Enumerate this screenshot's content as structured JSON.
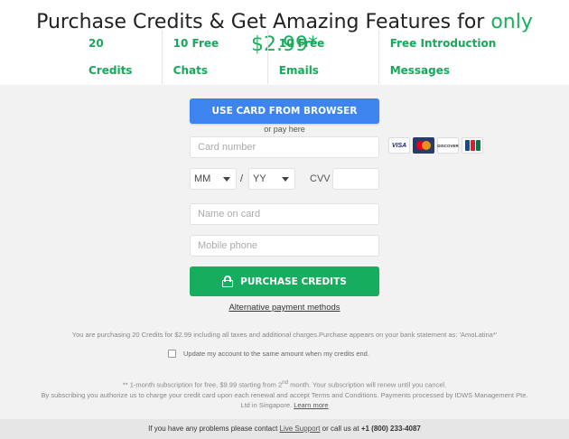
{
  "header": {
    "title_prefix": "Purchase Credits & Get Amazing Features for ",
    "title_accent": "only $2.99*",
    "features": [
      "20 Credits",
      "10 Free Chats",
      "10 Free Emails",
      "Free Introduction Messages"
    ]
  },
  "payment": {
    "browser_button": "USE CARD FROM BROWSER",
    "or_pay_here": "or pay here",
    "card_number_placeholder": "Card number",
    "card_brands": [
      "VISA",
      "mastercard",
      "DISCOVER",
      "JCB"
    ],
    "month_value": "MM",
    "year_value": "YY",
    "slash": "/",
    "cvv_label": "CVV",
    "name_placeholder": "Name on card",
    "phone_placeholder": "Mobile phone",
    "purchase_button": "PURCHASE CREDITS",
    "alt_payment_link": "Alternative payment methods"
  },
  "fineprint": {
    "line1": "You are purchasing 20 Credits for $2.99  including all taxes and additional charges.Purchase appears on your bank statement as: 'AmoLatina*'",
    "update_label": "Update my account to the same amount when my credits end.",
    "subscription_a": "** 1-month subscription for free, $9.99 starting from 2",
    "subscription_sup": "nd",
    "subscription_b": " month. Your subscription will renew until you cancel.",
    "line3": "By subscribing you authorize us to charge your credit card upon each renewal and accept Terms and Conditions. Payments processed by IDWS Management Pte. Ltd in Singapore.",
    "learn_more": "Learn more"
  },
  "footer": {
    "prefix": "If you have any problems please contact ",
    "live_support": "Live Support",
    "middle": " or call us at ",
    "phone": "+1 (800) 233-4087"
  }
}
